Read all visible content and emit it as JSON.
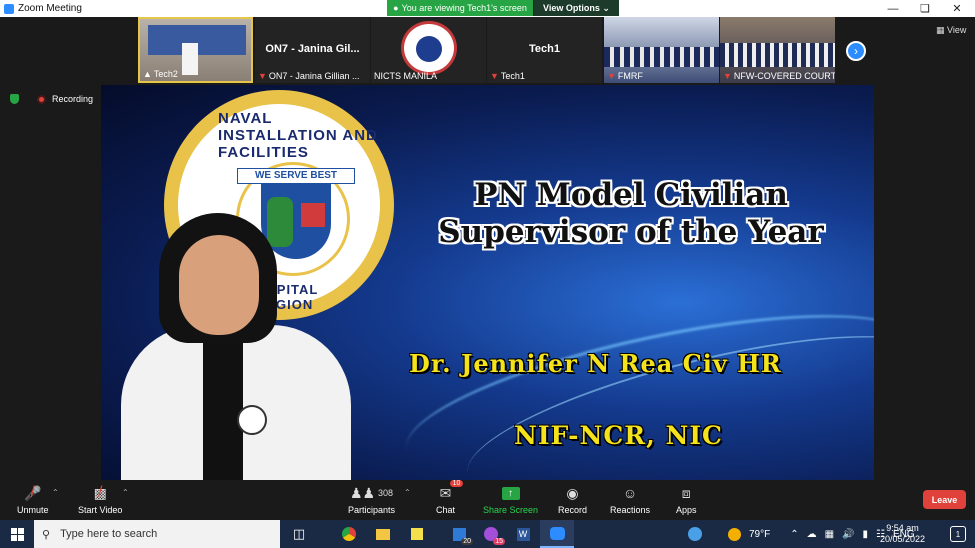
{
  "window": {
    "title": "Zoom Meeting",
    "viewing_banner": "You are viewing Tech1's screen",
    "view_options_label": "View Options",
    "minimize_icon": "minimize-icon",
    "maximize_icon": "maximize-icon",
    "close_icon": "close-icon"
  },
  "participants_strip": {
    "tiles": [
      {
        "caption": "Tech2",
        "center_name": "",
        "muted": false
      },
      {
        "caption": "ON7 - Janina Gillian ...",
        "center_name": "ON7 - Janina Gil...",
        "muted": true
      },
      {
        "caption": "NICTS MANILA",
        "center_name": "",
        "muted": false
      },
      {
        "caption": "Tech1",
        "center_name": "Tech1",
        "muted": true
      },
      {
        "caption": "FMRF",
        "center_name": "",
        "muted": true
      },
      {
        "caption": "NFW-COVERED COURT",
        "center_name": "",
        "muted": true
      }
    ],
    "view_label": "View"
  },
  "status": {
    "recording_label": "Recording"
  },
  "shared_slide": {
    "seal_banner": "WE SERVE BEST",
    "seal_top_text": "NAVAL INSTALLATION AND FACILITIES",
    "seal_bottom_text": "CAPITAL REGION",
    "title_line1": "PN Model Civilian",
    "title_line2": "Supervisor of the Year",
    "awardee": "Dr. Jennifer N Rea Civ HR",
    "organization": "NIF-NCR, NIC"
  },
  "toolbar": {
    "unmute_label": "Unmute",
    "start_video_label": "Start Video",
    "participants_label": "Participants",
    "participants_count": "308",
    "chat_label": "Chat",
    "chat_badge": "10",
    "share_screen_label": "Share Screen",
    "record_label": "Record",
    "reactions_label": "Reactions",
    "apps_label": "Apps",
    "leave_label": "Leave"
  },
  "taskbar": {
    "search_placeholder": "Type here to search",
    "teams_badge": "20",
    "messenger_badge": "15",
    "weather": "79°F",
    "language": "ENG",
    "time": "9:54 am",
    "date": "20/05/2022",
    "notification_count": "1"
  },
  "colors": {
    "accent_green": "#27a544",
    "leave_red": "#e0413b",
    "zoom_blue": "#2d8cff",
    "slide_yellow": "#f4e21a"
  }
}
